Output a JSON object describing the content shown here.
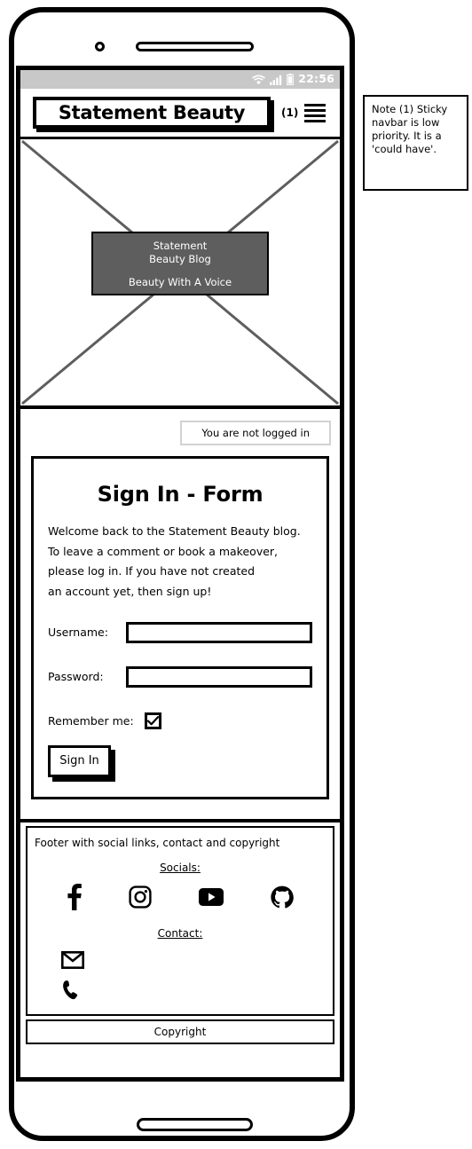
{
  "status_bar": {
    "time": "22:56",
    "icons": [
      "wifi-icon",
      "signal-icon",
      "battery-icon"
    ]
  },
  "navbar": {
    "brand": "Statement Beauty",
    "note_marker": "(1)",
    "menu_icon": "hamburger-icon"
  },
  "hero": {
    "placeholder_type": "image-placeholder",
    "title_line_1": "Statement",
    "title_line_2": "Beauty Blog",
    "tagline": "Beauty With A Voice",
    "overlay_color": "#5e5e5e"
  },
  "login_status": {
    "text": "You are not logged in"
  },
  "form": {
    "title": "Sign In - Form",
    "intro": [
      "Welcome back to the Statement Beauty blog.",
      "To leave a comment or book a makeover,",
      "please log in. If you have not created",
      "an account yet, then sign up!"
    ],
    "fields": [
      {
        "label": "Username:",
        "value": "",
        "placeholder": ""
      },
      {
        "label": "Password:",
        "value": "",
        "placeholder": ""
      }
    ],
    "remember_label": "Remember me:",
    "remember_checked": true,
    "submit_label": "Sign In"
  },
  "footer": {
    "caption": "Footer with social links, contact and copyright",
    "socials_heading": "Socials:",
    "socials": [
      {
        "name": "facebook-icon",
        "label": "Facebook"
      },
      {
        "name": "instagram-icon",
        "label": "Instagram"
      },
      {
        "name": "youtube-icon",
        "label": "YouTube"
      },
      {
        "name": "github-icon",
        "label": "GitHub"
      }
    ],
    "contact_heading": "Contact:",
    "contacts": [
      {
        "name": "email-icon",
        "label": "Email"
      },
      {
        "name": "phone-icon",
        "label": "Phone"
      }
    ],
    "copyright": "Copyright"
  },
  "note": {
    "text": "Note (1) Sticky navbar is low priority. It is a 'could have'."
  }
}
